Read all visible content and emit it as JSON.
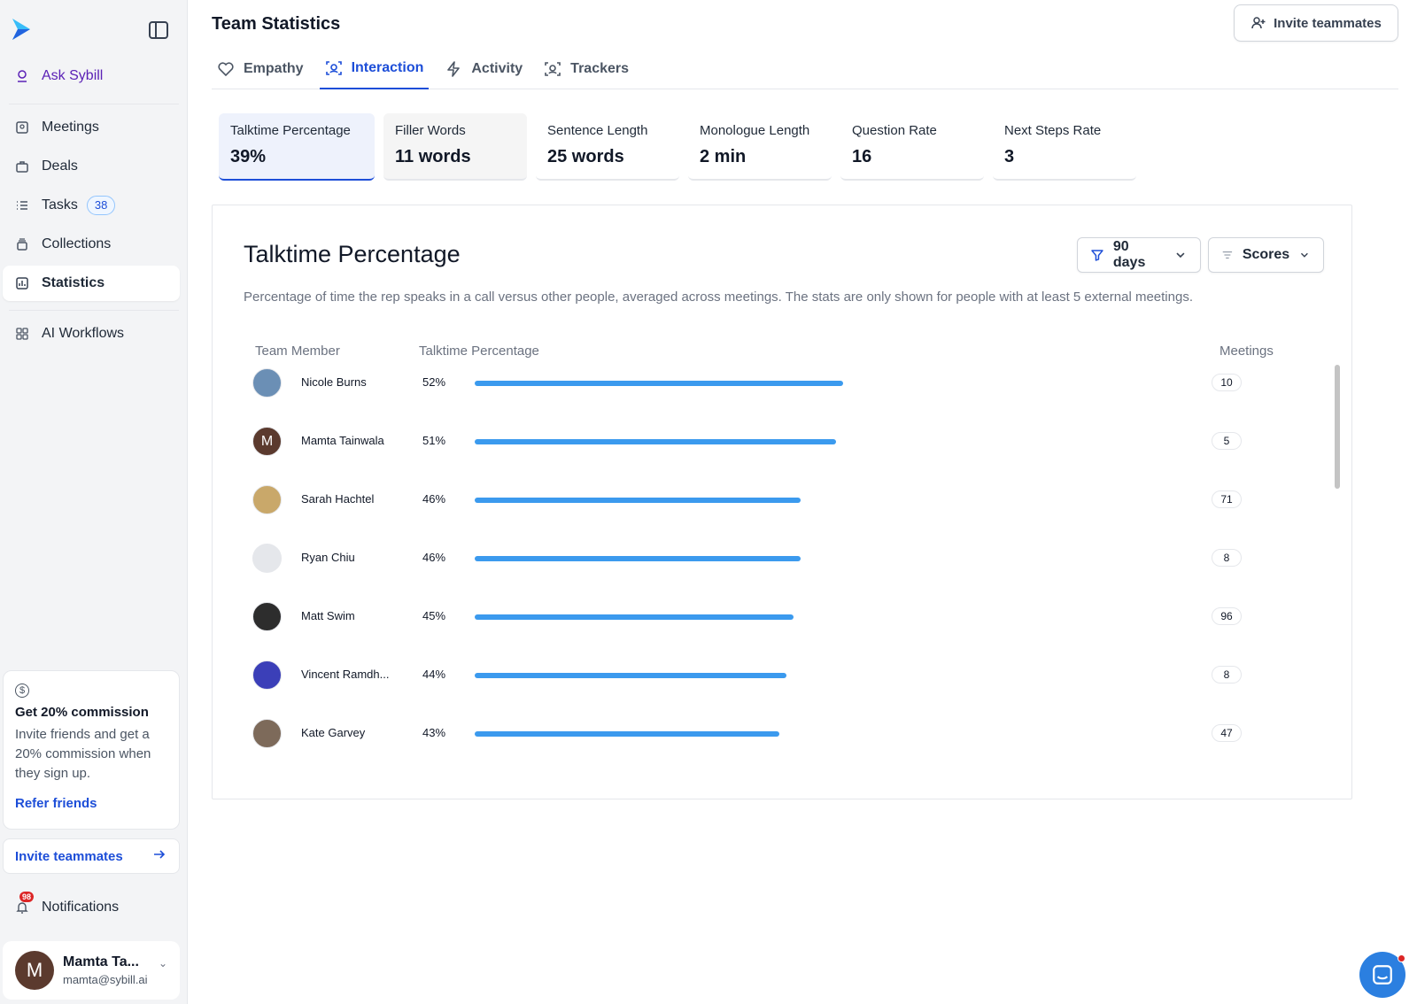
{
  "sidebar": {
    "ask": "Ask Sybill",
    "items": [
      {
        "label": "Meetings"
      },
      {
        "label": "Deals"
      },
      {
        "label": "Tasks",
        "badge": "38"
      },
      {
        "label": "Collections"
      },
      {
        "label": "Statistics"
      }
    ],
    "workflows": "AI Workflows",
    "promo": {
      "title": "Get 20% commission",
      "text": "Invite friends and get a 20% commission when they sign up.",
      "link": "Refer friends"
    },
    "invite": "Invite teammates",
    "notifications": {
      "label": "Notifications",
      "count": "98"
    },
    "profile": {
      "initial": "M",
      "name": "Mamta Ta...",
      "email": "mamta@sybill.ai"
    }
  },
  "header": {
    "title": "Team Statistics",
    "invite_button": "Invite teammates"
  },
  "tabs": [
    {
      "label": "Empathy",
      "icon": "heart-icon"
    },
    {
      "label": "Interaction",
      "icon": "scan-face-icon",
      "active": true
    },
    {
      "label": "Activity",
      "icon": "lightning-icon"
    },
    {
      "label": "Trackers",
      "icon": "scan-face-icon"
    }
  ],
  "metrics": [
    {
      "label": "Talktime Percentage",
      "value": "39%"
    },
    {
      "label": "Filler Words",
      "value": "11 words"
    },
    {
      "label": "Sentence Length",
      "value": "25 words"
    },
    {
      "label": "Monologue Length",
      "value": "2 min"
    },
    {
      "label": "Question Rate",
      "value": "16"
    },
    {
      "label": "Next Steps Rate",
      "value": "3"
    }
  ],
  "card": {
    "title": "Talktime Percentage",
    "filter_days": "90 days",
    "filter_scores": "Scores",
    "description": "Percentage of time the rep speaks in a call versus other people, averaged across meetings. The stats are only shown for people with at least 5 external meetings.",
    "columns": {
      "member": "Team Member",
      "metric": "Talktime Percentage",
      "meetings": "Meetings"
    }
  },
  "rows": [
    {
      "name": "Nicole Burns",
      "pct": "52%",
      "value": 52,
      "meetings": "10",
      "avatar_color": "#6b8fb5"
    },
    {
      "name": "Mamta Tainwala",
      "pct": "51%",
      "value": 51,
      "meetings": "5",
      "avatar_color": "#5b3a2e",
      "initial": "M"
    },
    {
      "name": "Sarah Hachtel",
      "pct": "46%",
      "value": 46,
      "meetings": "71",
      "avatar_color": "#c9a86a"
    },
    {
      "name": "Ryan Chiu",
      "pct": "46%",
      "value": 46,
      "meetings": "8",
      "avatar_color": "#e5e7eb"
    },
    {
      "name": "Matt Swim",
      "pct": "45%",
      "value": 45,
      "meetings": "96",
      "avatar_color": "#2d2d2d"
    },
    {
      "name": "Vincent Ramdh...",
      "pct": "44%",
      "value": 44,
      "meetings": "8",
      "avatar_color": "#3b3fb8"
    },
    {
      "name": "Kate Garvey",
      "pct": "43%",
      "value": 43,
      "meetings": "47",
      "avatar_color": "#7d6a5a"
    }
  ],
  "colors": {
    "accent": "#1d4ed8",
    "bar": "#3b9aee"
  }
}
